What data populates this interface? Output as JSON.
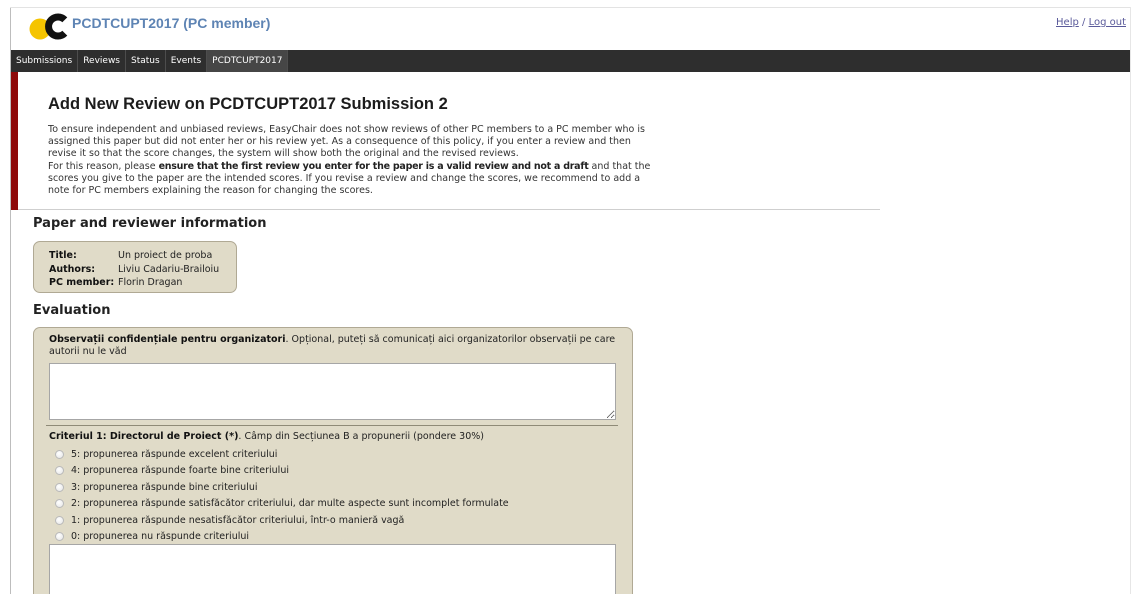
{
  "header": {
    "title": "PCDTCUPT2017 (PC member)",
    "help_label": "Help",
    "links_separator": "/",
    "logout_label": "Log out"
  },
  "menu": {
    "items": [
      {
        "label": "Submissions"
      },
      {
        "label": "Reviews"
      },
      {
        "label": "Status"
      },
      {
        "label": "Events"
      },
      {
        "label": "PCDTCUPT2017"
      }
    ]
  },
  "page": {
    "title": "Add New Review on PCDTCUPT2017 Submission 2",
    "intro_paragraph": "To ensure independent and unbiased reviews, EasyChair does not show reviews of other PC members to a PC member who is assigned this paper but did not enter her or his review yet. As a consequence of this policy, if you enter a review and then revise it so that the score changes, the system will show both the original and the revised reviews.",
    "warning_prefix": "For this reason, please ",
    "warning_emphasis": "ensure that the first review you enter for the paper is a valid review and not a draft",
    "warning_suffix": " and that the scores you give to the paper are the intended scores. If you revise a review and change the scores, we recommend to add a note for PC members explaining the reason for changing the scores."
  },
  "paper_info": {
    "heading": "Paper and reviewer information",
    "rows": [
      {
        "label": "Title:",
        "value": "Un proiect de proba"
      },
      {
        "label": "Authors:",
        "value": "Liviu Cadariu-Brailoiu"
      },
      {
        "label": "PC member:",
        "value": "Florin Dragan"
      }
    ]
  },
  "evaluation": {
    "heading": "Evaluation",
    "confidential": {
      "label_bold": "Observații confidențiale pentru organizatori",
      "label_rest": ". Opțional, puteți să comunicați aici organizatorilor observații pe care autorii nu le văd"
    },
    "criterion1": {
      "label_bold": "Criteriul 1: Directorul de Proiect (*)",
      "label_rest": ". Câmp din Secțiunea B a propunerii (pondere 30%)",
      "options": [
        "5: propunerea răspunde excelent criteriului",
        "4: propunerea răspunde foarte bine criteriului",
        "3: propunerea răspunde bine criteriului",
        "2: propunerea răspunde satisfăcător criteriului, dar multe aspecte sunt incomplet formulate",
        "1: propunerea răspunde nesatisfăcător criteriului, într-o manieră vagă",
        "0: propunerea nu răspunde criteriului"
      ]
    }
  },
  "icons": {
    "logo": "easychair-logo"
  },
  "colors": {
    "title": "#5e84b4",
    "link": "#5a5a9a",
    "menu_background": "#2e2e2e",
    "menu_current_background": "#464646",
    "accent_bar": "#8e0a0a",
    "panel_background": "#e0dbc8",
    "panel_border": "#b0a994",
    "logo_yellow": "#f5c400"
  }
}
